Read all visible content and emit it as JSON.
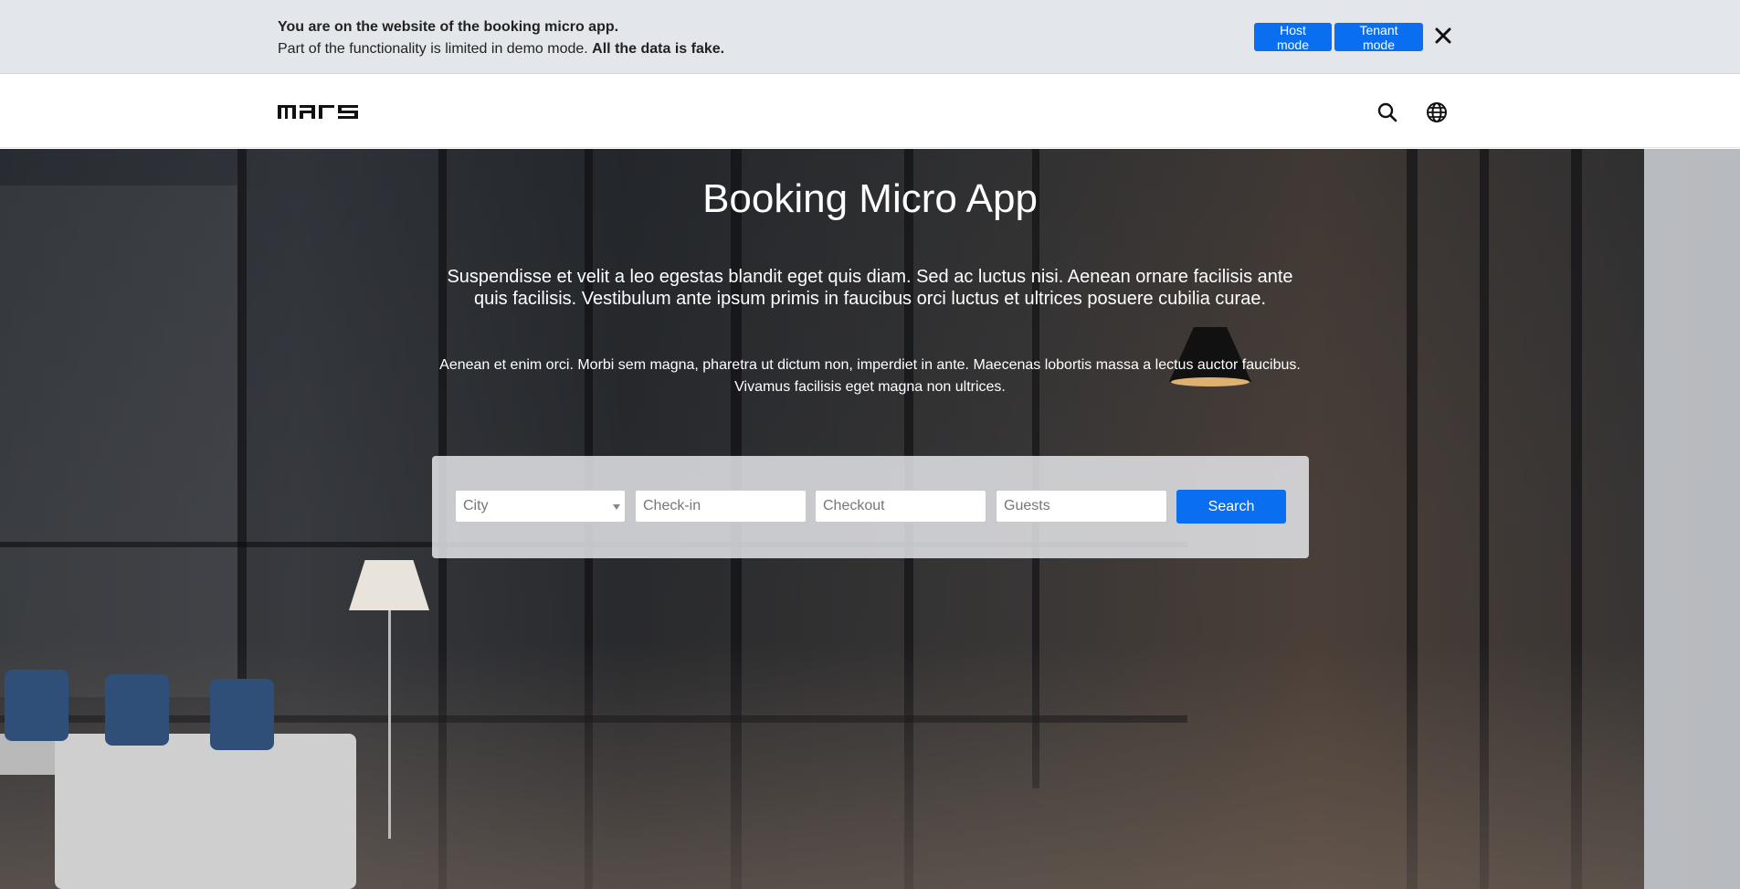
{
  "banner": {
    "line1": "You are on the website of the booking micro app.",
    "line2_prefix": "Part of the functionality is limited in demo mode. ",
    "line2_bold": "All the data is fake.",
    "host_mode_label": "Host mode",
    "tenant_mode_label": "Tenant mode",
    "close_icon": "close-icon"
  },
  "navbar": {
    "logo_text": "MARS",
    "search_icon": "search-icon",
    "language_icon": "globe-icon"
  },
  "hero": {
    "title": "Booking Micro App",
    "subtitle": "Suspendisse et velit a leo egestas blandit eget quis diam. Sed ac luctus nisi. Aenean ornare facilisis ante quis facilisis. Vestibulum ante ipsum primis in faucibus orci luctus et ultrices posuere cubilia curae.",
    "description": "Aenean et enim orci. Morbi sem magna, pharetra ut dictum non, imperdiet in ante. Maecenas lobortis massa a lectus auctor faucibus. Vivamus facilisis eget magna non ultrices."
  },
  "search_form": {
    "city_placeholder": "City",
    "checkin_placeholder": "Check-in",
    "checkout_placeholder": "Checkout",
    "guests_placeholder": "Guests",
    "search_label": "Search"
  },
  "colors": {
    "accent": "#0a6ef0",
    "banner_bg": "#e3e7eb"
  }
}
